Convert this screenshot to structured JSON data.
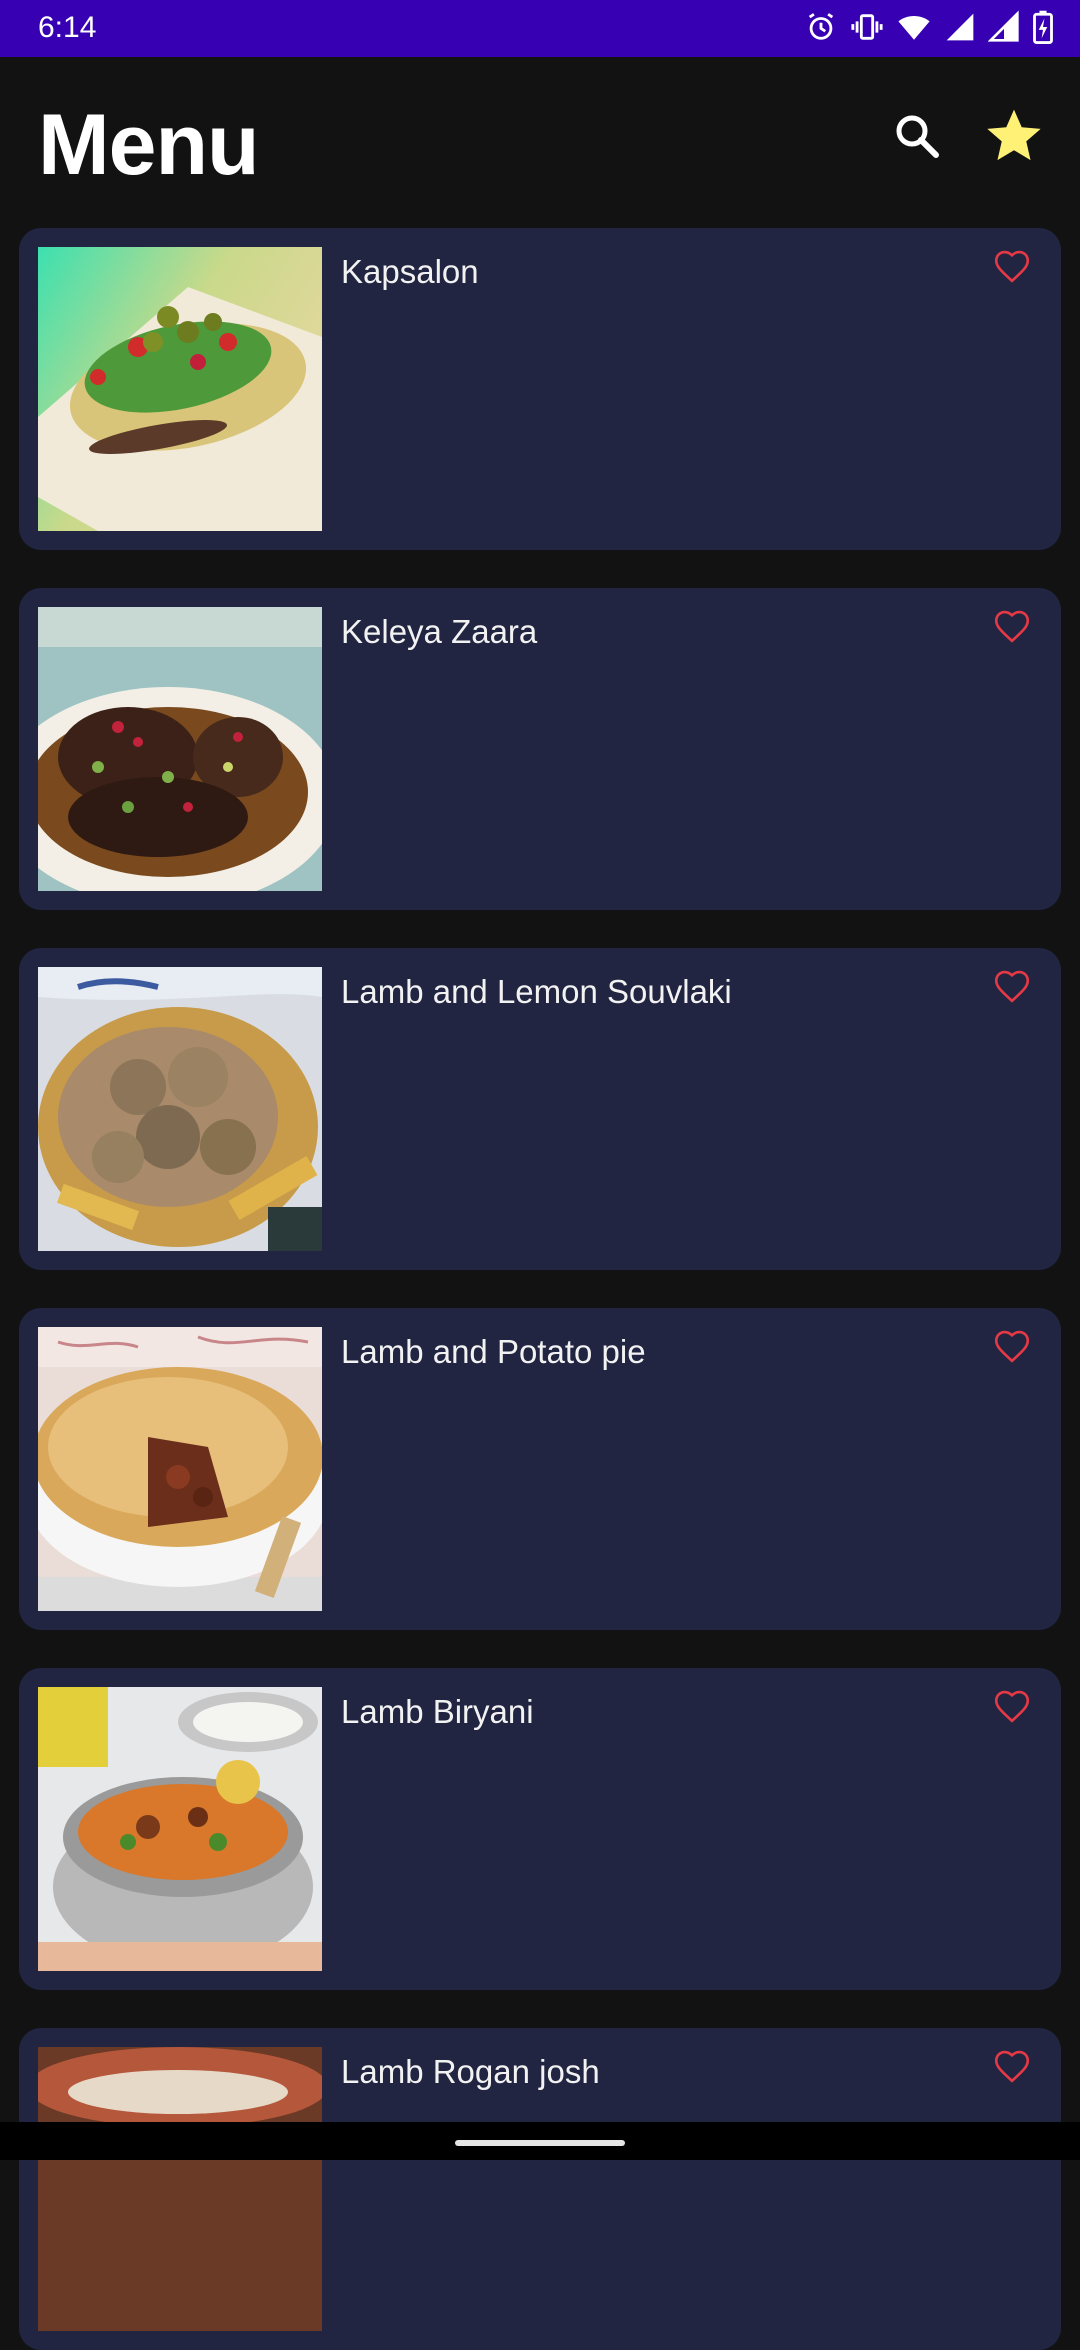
{
  "status_bar": {
    "time": "6:14",
    "icons": [
      "alarm-icon",
      "vibrate-icon",
      "wifi-icon",
      "signal-icon",
      "signal-icon",
      "battery-charging-icon"
    ],
    "background": "#3700b3"
  },
  "app_bar": {
    "title": "Menu",
    "actions": [
      {
        "name": "search-icon"
      },
      {
        "name": "star-icon",
        "color": "#fff176"
      }
    ]
  },
  "colors": {
    "background": "#121212",
    "card": "#212542",
    "favorite_outline": "#e53945"
  },
  "meals": [
    {
      "title": "Kapsalon",
      "favorite": false
    },
    {
      "title": "Keleya Zaara",
      "favorite": false
    },
    {
      "title": "Lamb and Lemon Souvlaki",
      "favorite": false
    },
    {
      "title": "Lamb and Potato pie",
      "favorite": false
    },
    {
      "title": "Lamb Biryani",
      "favorite": false
    },
    {
      "title": "Lamb Rogan josh",
      "favorite": false
    }
  ]
}
